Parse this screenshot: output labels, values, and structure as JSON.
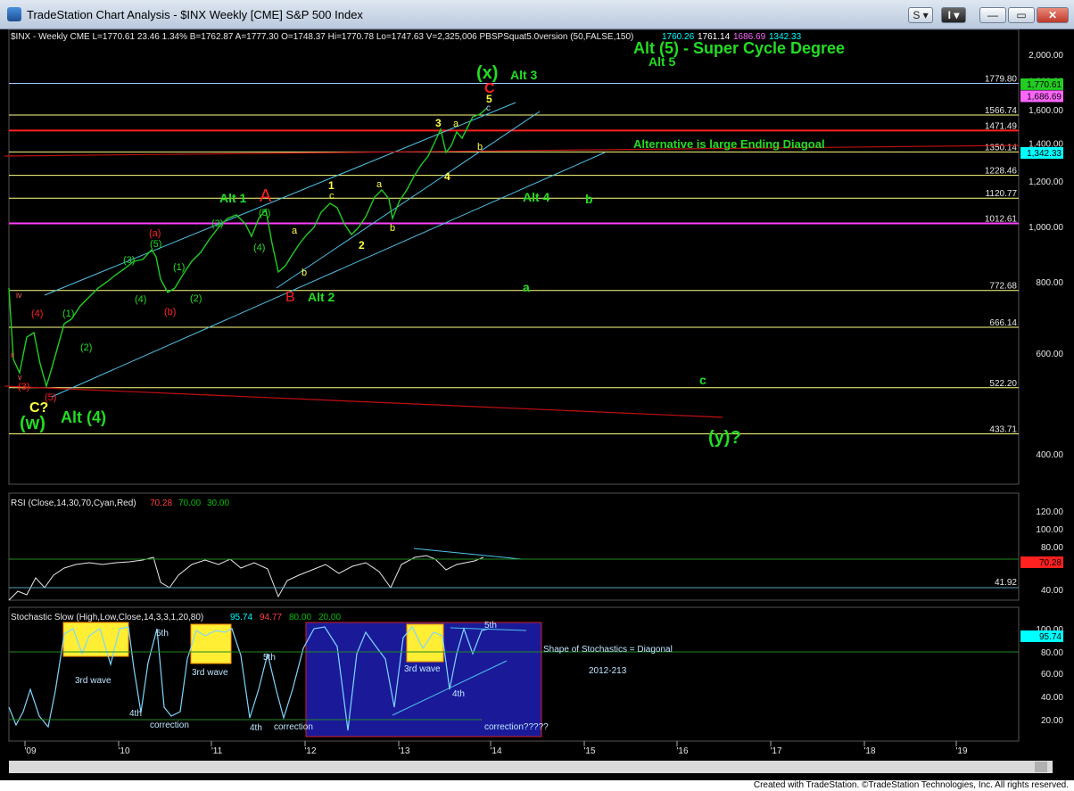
{
  "window": {
    "title": "TradeStation Chart Analysis - $INX Weekly [CME] S&P 500 Index",
    "buttons": {
      "s": "S",
      "i": "I",
      "minimize": "—",
      "restore": "▭",
      "close": "✕"
    }
  },
  "header": {
    "price_info": "$INX - Weekly  CME  L=1770.61  23.46  1.34%  B=1762.87  A=1777.30  O=1748.37  Hi=1770.78  Lo=1747.63  V=2,325,006  PBSPSquat5.0version (50,FALSE,150)",
    "indicator_values": [
      "1760.26",
      "1761.14",
      "1686.69",
      "1342.33"
    ],
    "indicator_colors": [
      "#00ffff",
      "#ffffff",
      "#ff66ff",
      "#00ffff"
    ]
  },
  "rsi": {
    "title": "RSI (Close,14,30,70,Cyan,Red)",
    "values": [
      "70.28",
      "70.00",
      "30.00"
    ],
    "value_colors": [
      "#ff4040",
      "#00c000",
      "#00c000"
    ],
    "axis": [
      "120.00",
      "100.00",
      "80.00",
      "60.00",
      "40.00"
    ],
    "current": "70.28",
    "level_label": "41.92"
  },
  "stochastic": {
    "title": "Stochastic Slow (High,Low,Close,14,3,3,1,20,80)",
    "values": [
      "95.74",
      "94.77",
      "80.00",
      "20.00"
    ],
    "value_colors": [
      "#00ffff",
      "#ff4040",
      "#00c000",
      "#00c000"
    ],
    "axis": [
      "100.00",
      "80.00",
      "60.00",
      "40.00",
      "20.00"
    ],
    "current": "95.74",
    "annotations": [
      {
        "text": "3rd wave",
        "color": "#bfe6ff"
      },
      {
        "text": "5th",
        "color": "#bfe6ff"
      },
      {
        "text": "4th",
        "color": "#bfe6ff"
      },
      {
        "text": "correction",
        "color": "#bfe6ff"
      },
      {
        "text": "3rd wave",
        "color": "#bfe6ff"
      },
      {
        "text": "5th",
        "color": "#bfe6ff"
      },
      {
        "text": "4th",
        "color": "#bfe6ff"
      },
      {
        "text": "correction",
        "color": "#bfe6ff"
      },
      {
        "text": "3rd wave",
        "color": "#bfe6ff"
      },
      {
        "text": "4th",
        "color": "#bfe6ff"
      },
      {
        "text": "5th",
        "color": "#bfe6ff"
      },
      {
        "text": "correction?????",
        "color": "#bfe6ff"
      },
      {
        "text": "Shape of Stochastics = Diagonal",
        "color": "#bfe6ff"
      },
      {
        "text": "2012-213",
        "color": "#bfe6ff"
      }
    ]
  },
  "price_axis": [
    "2,000.00",
    "1,800.00",
    "1,600.00",
    "1,400.00",
    "1,200.00",
    "1,000.00",
    "800.00",
    "600.00",
    "400.00"
  ],
  "price_tags": [
    {
      "text": "1,770.61",
      "bg": "#22cc22",
      "fg": "#000000"
    },
    {
      "text": "1,686.69",
      "bg": "#ff66ff",
      "fg": "#000000"
    },
    {
      "text": "1,342.33",
      "bg": "#00ffff",
      "fg": "#000000"
    }
  ],
  "level_lines": [
    {
      "value": 1779.8,
      "label": "1779.80",
      "color": "#9ecbff"
    },
    {
      "value": 1566.74,
      "label": "1566.74",
      "color": "#ffff80"
    },
    {
      "value": 1471.49,
      "label": "1471.49",
      "color": "#ff2020"
    },
    {
      "value": 1350.14,
      "label": "1350.14",
      "color": "#ffff80"
    },
    {
      "value": 1228.46,
      "label": "1228.46",
      "color": "#ffff80"
    },
    {
      "value": 1120.77,
      "label": "1120.77",
      "color": "#ffff80"
    },
    {
      "value": 1012.61,
      "label": "1012.61",
      "color": "#ff40ff"
    },
    {
      "value": 772.68,
      "label": "772.68",
      "color": "#ffff80"
    },
    {
      "value": 666.14,
      "label": "666.14",
      "color": "#ffff80"
    },
    {
      "value": 522.2,
      "label": "522.20",
      "color": "#ffff80"
    },
    {
      "value": 433.71,
      "label": "433.71",
      "color": "#ffff80"
    }
  ],
  "time_axis": [
    "'09",
    "'10",
    "'11",
    "'12",
    "'13",
    "'14",
    "'15",
    "'16",
    "'17",
    "'18",
    "'19"
  ],
  "wave_labels": [
    {
      "text": "Alt (5) - Super Cycle Degree",
      "color": "#22dd22"
    },
    {
      "text": "Alt 5",
      "color": "#22dd22"
    },
    {
      "text": "(x)",
      "color": "#22dd22"
    },
    {
      "text": "Alt 3",
      "color": "#22dd22"
    },
    {
      "text": "C",
      "color": "#ff2020"
    },
    {
      "text": "5",
      "color": "#ffff40"
    },
    {
      "text": "c",
      "color": "#9ecbff"
    },
    {
      "text": "3",
      "color": "#ffff40"
    },
    {
      "text": "a",
      "color": "#ffff40"
    },
    {
      "text": "b",
      "color": "#ffff40"
    },
    {
      "text": "4",
      "color": "#ffff40"
    },
    {
      "text": "1",
      "color": "#ffff40"
    },
    {
      "text": "c",
      "color": "#ffff40"
    },
    {
      "text": "a",
      "color": "#ffff40"
    },
    {
      "text": "b",
      "color": "#ffff40"
    },
    {
      "text": "2",
      "color": "#ffff40"
    },
    {
      "text": "a",
      "color": "#ffff40"
    },
    {
      "text": "b",
      "color": "#ffff40"
    },
    {
      "text": "Alternative is large Ending Diagoal",
      "color": "#22dd22"
    },
    {
      "text": "Alt 4",
      "color": "#22dd22"
    },
    {
      "text": "b",
      "color": "#22dd22"
    },
    {
      "text": "a",
      "color": "#22dd22"
    },
    {
      "text": "c",
      "color": "#22dd22"
    },
    {
      "text": "(y)?",
      "color": "#22dd22"
    },
    {
      "text": "A",
      "color": "#ff2020"
    },
    {
      "text": "Alt 1",
      "color": "#22dd22"
    },
    {
      "text": "(5)",
      "color": "#22dd22"
    },
    {
      "text": "(4)",
      "color": "#22dd22"
    },
    {
      "text": "(3)",
      "color": "#22dd22"
    },
    {
      "text": "B",
      "color": "#ff2020"
    },
    {
      "text": "Alt 2",
      "color": "#22dd22"
    },
    {
      "text": "(a)",
      "color": "#ff2020"
    },
    {
      "text": "(5)",
      "color": "#22dd22"
    },
    {
      "text": "(3)",
      "color": "#22dd22"
    },
    {
      "text": "(1)",
      "color": "#22dd22"
    },
    {
      "text": "(4)",
      "color": "#22dd22"
    },
    {
      "text": "(2)",
      "color": "#22dd22"
    },
    {
      "text": "(b)",
      "color": "#ff2020"
    },
    {
      "text": "(1)",
      "color": "#22dd22"
    },
    {
      "text": "(2)",
      "color": "#22dd22"
    },
    {
      "text": "(4)",
      "color": "#ff2020"
    },
    {
      "text": "iv",
      "color": "#ff6060"
    },
    {
      "text": "ii",
      "color": "#ff6060"
    },
    {
      "text": "v",
      "color": "#ff6060"
    },
    {
      "text": "(3)",
      "color": "#ff2020"
    },
    {
      "text": "(5)",
      "color": "#ff2020"
    },
    {
      "text": "C?",
      "color": "#ffff40"
    },
    {
      "text": "(w)",
      "color": "#22dd22"
    },
    {
      "text": "Alt (4)",
      "color": "#22dd22"
    }
  ],
  "status": {
    "text": "Created with TradeStation. ©TradeStation Technologies, Inc. All rights reserved."
  }
}
